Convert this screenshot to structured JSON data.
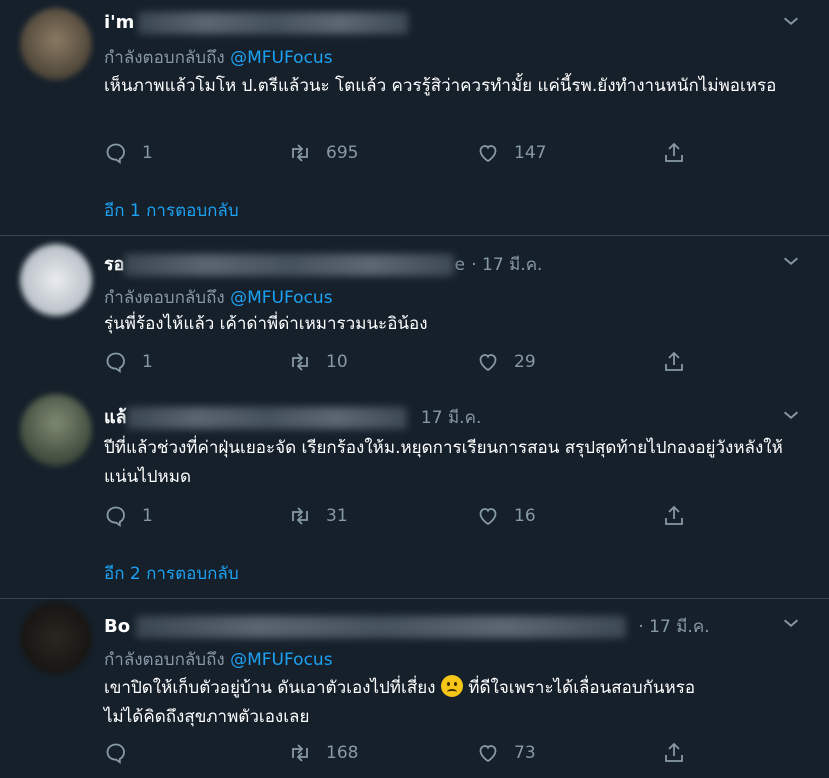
{
  "colors": {
    "background": "#15202b",
    "divider": "#38444d",
    "muted": "#8899a6",
    "accent": "#1da1f2",
    "text": "#ffffff"
  },
  "icons": {
    "menu": "chevron-down-icon",
    "reply": "comment-icon",
    "retweet": "retweet-icon",
    "like": "heart-icon",
    "share": "share-icon"
  },
  "tweets": [
    {
      "name": "i'm",
      "date": "",
      "reply_prefix": "กำลังตอบกลับถึง",
      "reply_handle": "@MFUFocus",
      "text": "เห็นภาพแล้วโมโห ป.ตรีแล้วนะ โตแล้ว ควรรู้สิว่าควรทำมั้ย แค่นี้รพ.ยังทำงานหนักไม่พอเหรอ",
      "replies": "1",
      "retweets": "695",
      "likes": "147",
      "more_replies": "อีก 1 การตอบกลับ"
    },
    {
      "name": "รอ",
      "name_tail": "e",
      "date": "· 17 มี.ค.",
      "reply_prefix": "กำลังตอบกลับถึง",
      "reply_handle": "@MFUFocus",
      "text": "รุ่นพี่ร้องไห้แล้ว เค้าด่าพี่ด่าเหมารวมนะอิน้อง",
      "replies": "1",
      "retweets": "10",
      "likes": "29"
    },
    {
      "name": "แล้",
      "date": "17 มี.ค.",
      "text": "ปีที่แล้วช่วงที่ค่าฝุ่นเยอะจัด เรียกร้องให้ม.หยุดการเรียนการสอน สรุปสุดท้ายไปกองอยู่วังหลังให้แน่นไปหมด",
      "replies": "1",
      "retweets": "31",
      "likes": "16",
      "more_replies": "อีก 2 การตอบกลับ"
    },
    {
      "name": "Bo",
      "date": "· 17 มี.ค.",
      "reply_prefix": "กำลังตอบกลับถึง",
      "reply_handle": "@MFUFocus",
      "text_a": "เขาปิดให้เก็บตัวอยู่บ้าน ดันเอาตัวเองไปที่เสี่ยง",
      "text_b": "ที่ดีใจเพราะได้เลื่อนสอบกันหรอ",
      "text_c": "ไม่ได้คิดถึงสุขภาพตัวเองเลย",
      "replies": "",
      "retweets": "168",
      "likes": "73"
    }
  ]
}
